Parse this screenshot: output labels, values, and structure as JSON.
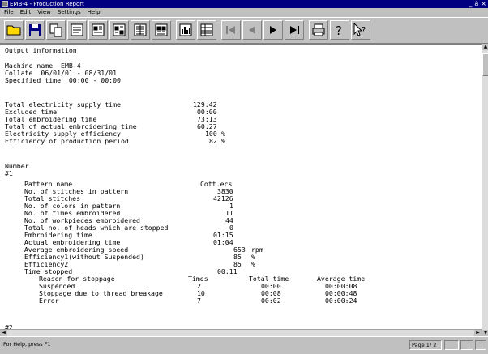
{
  "window": {
    "title": "EMB-4 - Production Report",
    "controls": [
      "_",
      "á",
      "×"
    ]
  },
  "menu": [
    "File",
    "Edit",
    "View",
    "Settings",
    "Help"
  ],
  "toolbar": [
    "open-icon",
    "save-icon",
    "copy-icon",
    "report-icon",
    "report-icon",
    "report-icon",
    "report-icon",
    "report-icon",
    "chart-icon",
    "table-icon",
    "first-page-icon",
    "prev-page-icon",
    "next-page-icon",
    "last-page-icon",
    "print-icon",
    "help-icon",
    "context-help-icon"
  ],
  "doc": {
    "heading": "Output information",
    "machine": "Machine name  EMB-4",
    "collate": "Collate  06/01/01 - 08/31/01",
    "specified": "Specified time  00:00 - 00:00",
    "summary": [
      {
        "label": "Total electricity supply time",
        "value": "129:42",
        "unit": ""
      },
      {
        "label": "Excluded time",
        "value": "00:00",
        "unit": ""
      },
      {
        "label": "Total embroidering time",
        "value": "73:13",
        "unit": ""
      },
      {
        "label": "Total of actual embroidering time",
        "value": "60:27",
        "unit": ""
      },
      {
        "label": "Electricity supply efficiency",
        "value": "100",
        "unit": "%"
      },
      {
        "label": "Efficiency of production period",
        "value": "82",
        "unit": "%"
      }
    ],
    "number_label": "Number",
    "entry_label": "#1",
    "details": [
      {
        "label": "Pattern name",
        "value": "Cott.ecs",
        "unit": ""
      },
      {
        "label": "No. of stitches in pattern",
        "value": "3830",
        "unit": ""
      },
      {
        "label": "Total stitches",
        "value": "42126",
        "unit": ""
      },
      {
        "label": "No. of colors in pattern",
        "value": "1",
        "unit": ""
      },
      {
        "label": "No. of times embroidered",
        "value": "11",
        "unit": ""
      },
      {
        "label": "No. of workpieces embroidered",
        "value": "44",
        "unit": ""
      },
      {
        "label": "Total no. of heads which are stopped",
        "value": "0",
        "unit": ""
      },
      {
        "label": "Embroidering time",
        "value": "01:15",
        "unit": ""
      },
      {
        "label": "Actual embroidering time",
        "value": "01:04",
        "unit": ""
      },
      {
        "label": "Average embroidering speed",
        "value": "653",
        "unit": "rpm"
      },
      {
        "label": "Efficiency1(without Suspended)",
        "value": "85",
        "unit": "%"
      },
      {
        "label": "Efficiency2",
        "value": "85",
        "unit": "%"
      },
      {
        "label": "Time stopped",
        "value": "00:11",
        "unit": ""
      }
    ],
    "stoppage_header": {
      "reason": "Reason for stoppage",
      "times": "Times",
      "total": "Total time",
      "average": "Average time"
    },
    "stoppage_rows": [
      {
        "reason": "Suspended",
        "times": "2",
        "total": "00:00",
        "average": "00:00:08"
      },
      {
        "reason": "Stoppage due to thread breakage",
        "times": "10",
        "total": "00:08",
        "average": "00:00:48"
      },
      {
        "reason": "Error",
        "times": "7",
        "total": "00:02",
        "average": "00:00:24"
      }
    ],
    "next_entry_label": "#2"
  },
  "status": {
    "help": "For Help, press F1",
    "page": "Page  1/ 2"
  }
}
